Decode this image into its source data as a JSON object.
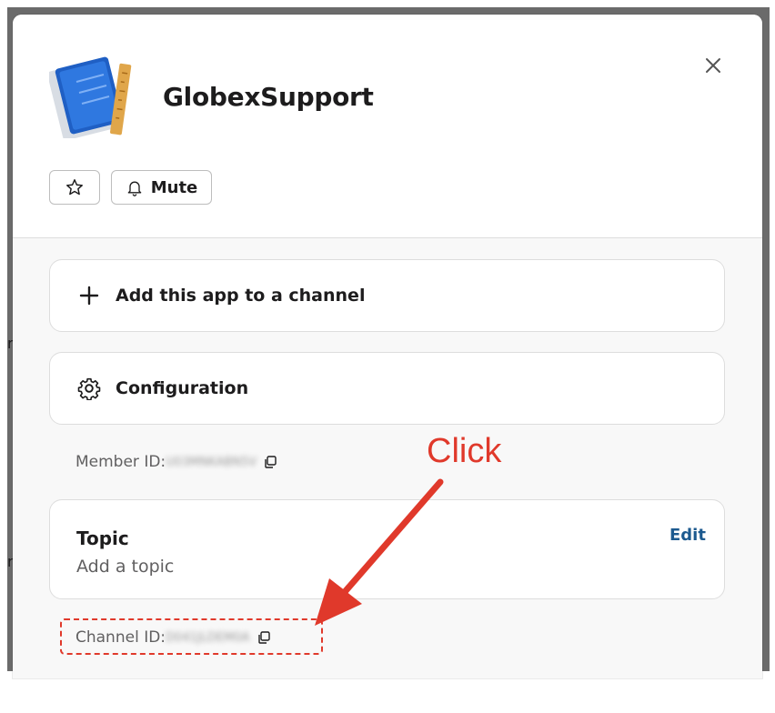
{
  "background": {
    "edge_glyphs": [
      "re",
      "re"
    ]
  },
  "dialog": {
    "app_name": "GlobexSupport",
    "app_icon": "blueprint-book-icon",
    "close_icon": "close-icon",
    "star_icon": "star-icon",
    "mute_icon": "bell-icon",
    "mute_label": "Mute"
  },
  "actions": [
    {
      "icon": "plus-icon",
      "label": "Add this app to a channel"
    },
    {
      "icon": "gear-icon",
      "label": "Configuration"
    }
  ],
  "member_id": {
    "label": "Member ID:",
    "value": "U03MNKABN5V",
    "copy_icon": "copy-icon"
  },
  "topic": {
    "title": "Topic",
    "placeholder": "Add a topic",
    "edit_label": "Edit"
  },
  "channel_id": {
    "label": "Channel ID:",
    "value": "D041JLDEM0A",
    "copy_icon": "copy-icon"
  },
  "annotation": {
    "text": "Click",
    "color": "#e0392b"
  },
  "colors": {
    "link": "#1d5a8f",
    "annotation": "#e0392b",
    "text_primary": "#1d1c1d",
    "text_secondary": "#616061"
  }
}
